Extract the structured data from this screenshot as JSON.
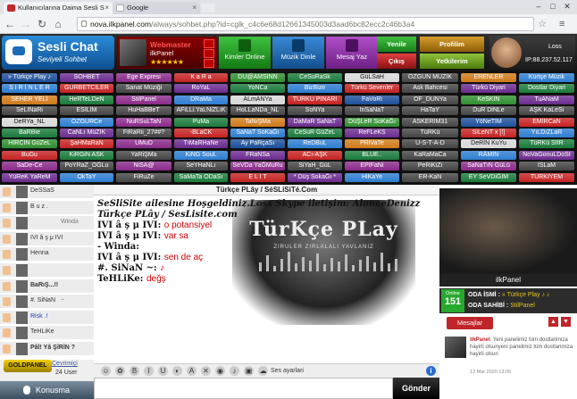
{
  "browser": {
    "tab1_title": "Kullanıcılarına Daima Sesli S",
    "tab2_title": "Google",
    "url_host": "nova.ilkpanel.com",
    "url_path": "/always/sohbet.php?id=cglk_c4c6e68d12661345003d3aad6bc82ecc2c46b3a4"
  },
  "header": {
    "logo_title": "Sesli Chat",
    "logo_subtitle": "Seviyeli Sohbet",
    "webmaster_label": "Webmaster",
    "webmaster_name": "ilkPanel",
    "webmaster_stars": "★★★★★★",
    "kimler_label": "Kimler Online",
    "muzik_label": "Müzik Dinle",
    "mesaj_label": "Mesaj Yaz",
    "yenile_label": "Yenile",
    "cikis_label": "Çıkış",
    "profil_label": "Profilim",
    "yetki_label": "Yetkilerim",
    "user_name": "Loss",
    "user_ip": "IP:88.237.52.117"
  },
  "rooms": [
    [
      "» Türkçe Play ♪",
      "SOHBET",
      "Ege Expresi",
      "K a R a",
      "DU@AMSINN",
      "CeSuRaSk",
      "GüLSaH",
      "ÖZGÜN MÜZİK",
      "ERENLER",
      "Kürtçe Müzik"
    ],
    [
      "S İ R İ N L E R",
      "GURBETCİLER",
      "Sanat Müziği",
      "RoYaL",
      "YoNCa",
      "BizBize",
      "Türkü Sevenler",
      "Ask Bahcesi",
      "Türkü Diyari",
      "Dostlar Diyari"
    ],
    [
      "SEHER YELİ",
      "HeRTeLDeN",
      "StilPanel",
      "DRaMa",
      "ALmANYa",
      "TÜRKÜ PINARI",
      "FaVoRi",
      "OF_DUNYa",
      "KeSKİN",
      "TuANaM"
    ],
    [
      "SeLİNaRi",
      "ESİLİM",
      "HuHaBBeT",
      "AFiLLi.YaLNiZLıK",
      "HoLLaNDa_NL",
      "SoNYa",
      "İnSaNaT",
      "HaTaY",
      "DuR DiNLe",
      "AŞK KaLeSi"
    ],
    [
      "DeRYa_NL",
      "ÖZGÜRCe",
      "NuRSuLTaN",
      "PuMa",
      "TaNıŞMa",
      "DaMaR SaNaT",
      "DüŞLeR SoKaĞı",
      "ASKERİM31",
      "YöNeTİM",
      "EMİRCaN"
    ],
    [
      "BaRBie",
      "CaNLı MüZİK",
      "FiRaRii_27##?",
      "-BLaCK",
      "SaNaT SoKaĞı",
      "CeSuR GüZeL",
      "ReFLeKS",
      "TüRKü",
      "SiLeNT x [!]",
      "YıLDıZLaR"
    ],
    [
      "HİRCİN GüZeL",
      "ŞaHMaRaN",
      "UMuD",
      "TıMaRHaNe",
      "Ay PaRçaSı",
      "ReDBuL",
      "PRiVaTe",
      "U-S-T-A-D",
      "DeRİN KuYu",
      "TüRKü SİİR"
    ],
    [
      "BuGu",
      "KiRGiN ASK",
      "YaRiŞMa",
      "KiNG SouL",
      "FRaNSa",
      "ACı-AŞK",
      "BLUE..",
      "KaRaMaCa",
      "RÂMİN",
      "NoVaGonuLDoSt"
    ],
    [
      "SaDe-Ce",
      "PoYRaZ_OĞLu",
      "NiSA@",
      "SeYHaNLı",
      "SeVDa YaĞMuRu",
      "SiYaH_GüL",
      "EPİFaNi",
      "PeRiKiZi",
      "SaNaTıN GüLü",
      "İSLaM"
    ],
    [
      "YüReK YaReM",
      "OkTaY",
      "FiRuZe",
      "SaMaTa ODaSı",
      "E L İ T",
      "* Düş SokaĞı *",
      "HiKaYe",
      "ER-KaN",
      "EY SeVDiĞİM",
      "TÜRKİYEM"
    ]
  ],
  "userlist": [
    {
      "name": "DeSSaS",
      "extra": ""
    },
    {
      "name": "B u z .",
      "extra": ""
    },
    {
      "name": "",
      "extra": "Winda"
    },
    {
      "name": "IVI â ş μ IVI",
      "extra": ""
    },
    {
      "name": "Henna",
      "extra": ""
    },
    {
      "name": "",
      "extra": ""
    },
    {
      "name": "BaRıŞ...!!",
      "extra": ""
    },
    {
      "name": "#. SiNaN",
      "extra": "~"
    },
    {
      "name": "Risk .!",
      "extra": ""
    },
    {
      "name": "TeHLiKe",
      "extra": ""
    },
    {
      "name": "Pâl! Yâ ŞîRîN ?",
      "extra": ""
    }
  ],
  "list_footer": {
    "badge": "GOLDPANEL",
    "online_label": "Çevrimiçi",
    "online_count": "24 User",
    "konusma": "Konusma"
  },
  "chat": {
    "room_title": "Türkçe PLây / SéSLiSiTé.Com",
    "banner_title": "TürKçe PLay",
    "banner_sub": "ZIRULER  ZIRLALALI  YAVLANIZ",
    "messages": [
      {
        "user": "SeSliSite ailesine Hoşgeldiniz.Loss Skype iletişim: AloneeDenizz",
        "text": ""
      },
      {
        "user": "Türkçe PLây / SesLisite.com",
        "text": ""
      },
      {
        "user": "IVI â ş μ IVI:",
        "text": "o potansiyel"
      },
      {
        "user": "IVI â ş μ IVI:",
        "text": "var sa"
      },
      {
        "user": "- Winda:",
        "text": ""
      },
      {
        "user": "IVI â ş μ IVI:",
        "text": "sen de aç"
      },
      {
        "user": "#. SiNaN ~:",
        "text": "♪"
      },
      {
        "user": "TeHLiKe:",
        "text": "değş"
      }
    ],
    "ses_label": "Ses ayarlari",
    "send_label": "Gönder"
  },
  "right_panel": {
    "photo_name": "ilkPanel",
    "online_label": "Online",
    "online_count": "151",
    "oda_isim_label": "ODA İSMİ :",
    "oda_isim_value": "» Türkçe Play ♪ ♪",
    "oda_sahip_label": "ODA SAHİBİ :",
    "oda_sahip_value": "StilPanel",
    "mesajlar": "Mesajlar",
    "msg_from": "ilkPanel",
    "msg_text": ": Yeni panelimiz tüm dostlarimiza hayirli olsunyeni panelimiz tüm dostlarimiza hayirli olsun",
    "msg_time": "13 Mar 2020 13:05"
  },
  "colors": {
    "accent_red": "#c0252a",
    "online_green": "#27a82e",
    "room_palette": [
      "#1d4f9b",
      "#c62222",
      "#d8d8d8",
      "#2d7dd1",
      "#8a2a8a",
      "#1a7a3a",
      "#d07a1a",
      "#6b2b8f",
      "#2f8f2f",
      "#444"
    ]
  }
}
